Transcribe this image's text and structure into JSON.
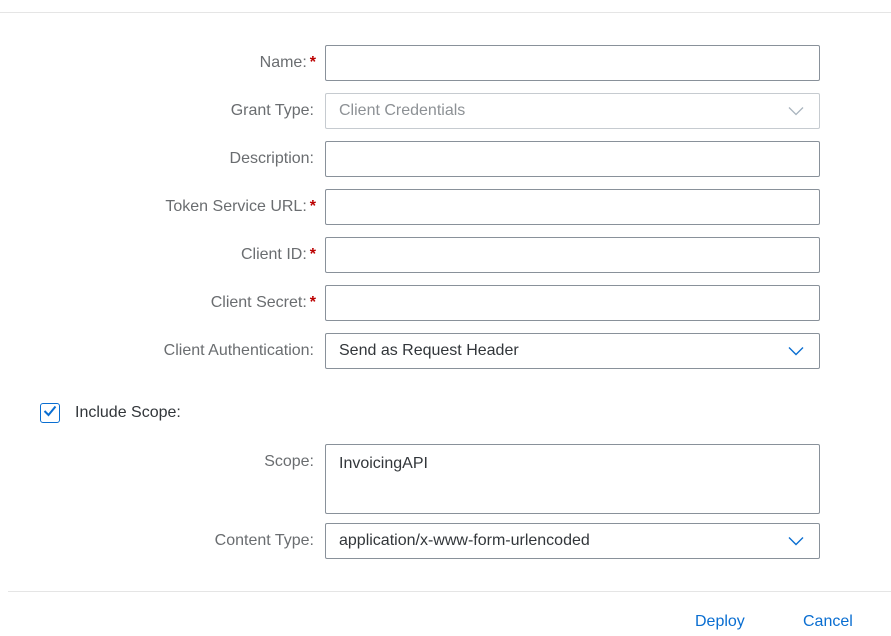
{
  "form": {
    "name": {
      "label": "Name:",
      "required_mark": "*",
      "value": ""
    },
    "grant_type": {
      "label": "Grant Type:",
      "value": "Client Credentials"
    },
    "description": {
      "label": "Description:",
      "value": ""
    },
    "token_service_url": {
      "label": "Token Service URL:",
      "required_mark": "*",
      "value": ""
    },
    "client_id": {
      "label": "Client ID:",
      "required_mark": "*",
      "value": ""
    },
    "client_secret": {
      "label": "Client Secret:",
      "required_mark": "*",
      "value": ""
    },
    "client_authentication": {
      "label": "Client Authentication:",
      "value": "Send as Request Header"
    },
    "include_scope": {
      "label": "Include Scope:",
      "checked": true
    },
    "scope": {
      "label": "Scope:",
      "value": "InvoicingAPI"
    },
    "content_type": {
      "label": "Content Type:",
      "value": "application/x-www-form-urlencoded"
    }
  },
  "footer": {
    "deploy_label": "Deploy",
    "cancel_label": "Cancel"
  },
  "colors": {
    "accent": "#0a6ed1",
    "required": "#bb0000",
    "label": "#6a6d70",
    "text": "#32363a"
  },
  "icons": {
    "dropdown": "chevron-down-icon",
    "checkbox": "checkmark-icon"
  }
}
